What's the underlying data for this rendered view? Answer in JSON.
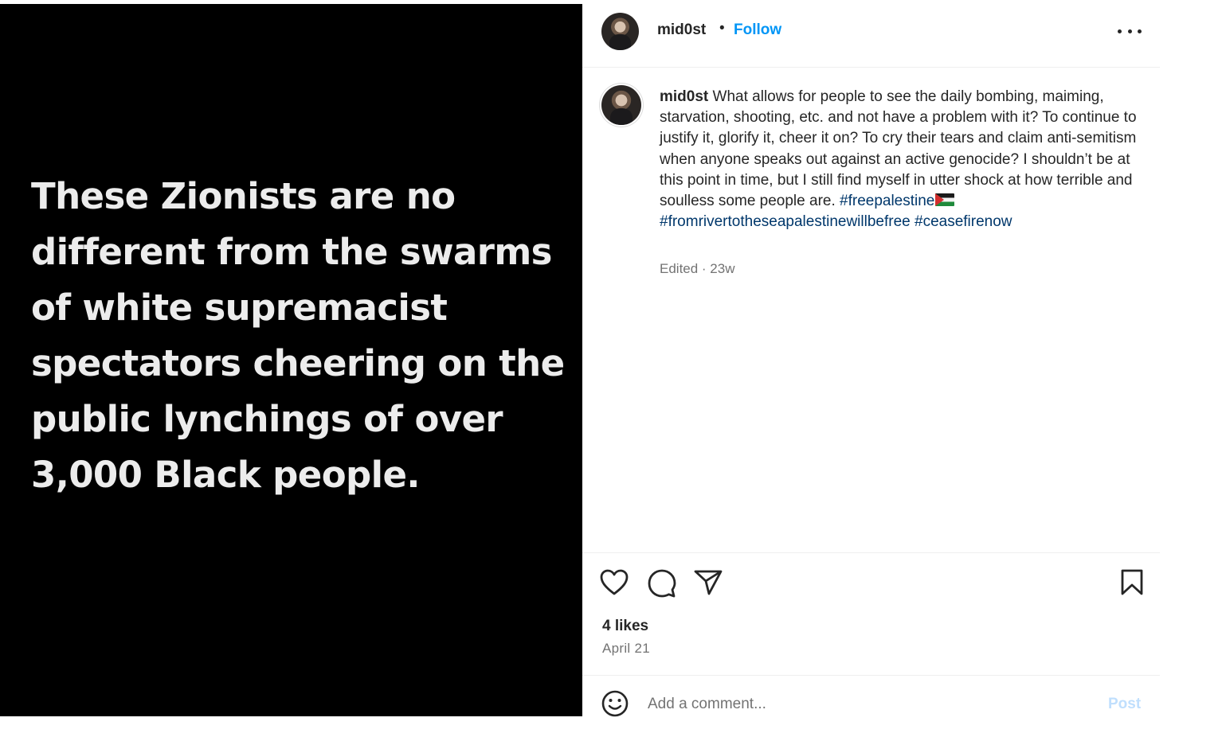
{
  "post": {
    "image_text": "These Zionists are no different from the swarms of white supremacist spectators cheering on the public lynchings of over 3,000 Black people."
  },
  "header": {
    "username": "mid0st",
    "separator": "•",
    "follow_label": "Follow",
    "more_icon": "more-horizontal-icon"
  },
  "caption": {
    "username": "mid0st",
    "text": " What allows for people to see the daily bombing, maiming, starvation, shooting, etc. and not have a problem with it? To continue to justify it, glorify it, cheer it on? To cry their tears and claim anti-semitism when anyone speaks out against an active genocide? I shouldn’t be at this point in time, but I still find myself in utter shock at how terrible and soulless some people are. ",
    "hashtags": [
      "#freepalestine",
      "#fromrivertotheseapalestinewillbefree",
      "#ceasefirenow"
    ],
    "flag_emoji": "palestine-flag",
    "meta": "Edited · 23w"
  },
  "actions": {
    "icons": [
      "heart-icon",
      "comment-icon",
      "share-icon",
      "bookmark-icon"
    ],
    "likes": "4 likes",
    "date": "April 21"
  },
  "comment": {
    "placeholder": "Add a comment...",
    "post_label": "Post",
    "emoji_icon": "emoji-icon"
  },
  "colors": {
    "link_blue": "#0095f6",
    "hashtag": "#00376b",
    "text": "#262626",
    "secondary": "#737373",
    "post_disabled": "#c0dffd"
  }
}
